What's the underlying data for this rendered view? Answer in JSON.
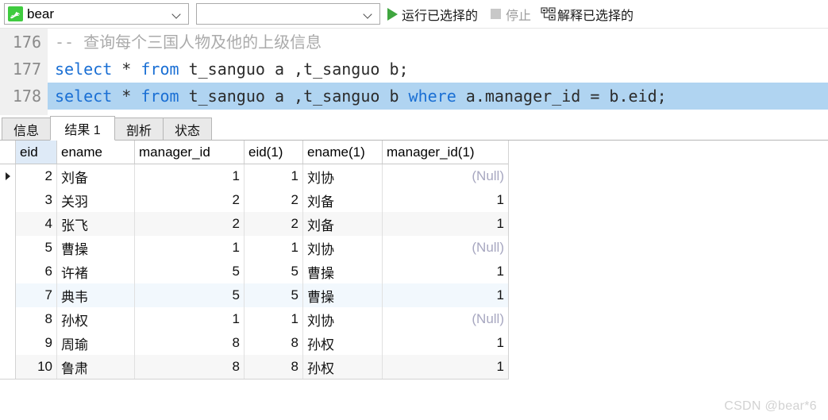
{
  "toolbar": {
    "database_value": "bear",
    "schema_value": "",
    "run_selected_label": "运行已选择的",
    "stop_label": "停止",
    "explain_selected_label": "解释已选择的",
    "accent_green": "#3fa63f"
  },
  "editor": {
    "lines": [
      {
        "number": "176",
        "selected": false,
        "tokens": [
          {
            "t": "-- 查询每个三国人物及他的上级信息",
            "k": "comment"
          }
        ]
      },
      {
        "number": "177",
        "selected": false,
        "tokens": [
          {
            "t": "select",
            "k": "keyword"
          },
          {
            "t": " * ",
            "k": "plain"
          },
          {
            "t": "from",
            "k": "keyword"
          },
          {
            "t": " t_sanguo a ,t_sanguo b;",
            "k": "plain"
          }
        ]
      },
      {
        "number": "178",
        "selected": true,
        "tokens": [
          {
            "t": "select",
            "k": "keyword"
          },
          {
            "t": " * ",
            "k": "plain"
          },
          {
            "t": "from",
            "k": "keyword"
          },
          {
            "t": " t_sanguo a ,t_sanguo b ",
            "k": "plain"
          },
          {
            "t": "where",
            "k": "keyword"
          },
          {
            "t": " a.manager_id = b.eid;",
            "k": "plain"
          }
        ]
      }
    ]
  },
  "result_tabs": [
    {
      "label": "信息",
      "active": false
    },
    {
      "label": "结果 1",
      "active": true
    },
    {
      "label": "剖析",
      "active": false
    },
    {
      "label": "状态",
      "active": false
    }
  ],
  "grid": {
    "columns": [
      "eid",
      "ename",
      "manager_id",
      "eid(1)",
      "ename(1)",
      "manager_id(1)"
    ],
    "selected_column": "eid",
    "current_row_index": 0,
    "rows": [
      {
        "cells": [
          "2",
          "刘备",
          "1",
          "1",
          "刘协",
          "(Null)"
        ],
        "stripe": false,
        "highlight": false,
        "current": true
      },
      {
        "cells": [
          "3",
          "关羽",
          "2",
          "2",
          "刘备",
          "1"
        ],
        "stripe": false,
        "highlight": false,
        "current": false
      },
      {
        "cells": [
          "4",
          "张飞",
          "2",
          "2",
          "刘备",
          "1"
        ],
        "stripe": true,
        "highlight": false,
        "current": false
      },
      {
        "cells": [
          "5",
          "曹操",
          "1",
          "1",
          "刘协",
          "(Null)"
        ],
        "stripe": false,
        "highlight": false,
        "current": false
      },
      {
        "cells": [
          "6",
          "许褚",
          "5",
          "5",
          "曹操",
          "1"
        ],
        "stripe": false,
        "highlight": false,
        "current": false
      },
      {
        "cells": [
          "7",
          "典韦",
          "5",
          "5",
          "曹操",
          "1"
        ],
        "stripe": false,
        "highlight": true,
        "current": false
      },
      {
        "cells": [
          "8",
          "孙权",
          "1",
          "1",
          "刘协",
          "(Null)"
        ],
        "stripe": false,
        "highlight": false,
        "current": false
      },
      {
        "cells": [
          "9",
          "周瑜",
          "8",
          "8",
          "孙权",
          "1"
        ],
        "stripe": false,
        "highlight": false,
        "current": false
      },
      {
        "cells": [
          "10",
          "鲁肃",
          "8",
          "8",
          "孙权",
          "1"
        ],
        "stripe": true,
        "highlight": false,
        "current": false
      }
    ]
  },
  "watermark": {
    "text": "CSDN @bear*6"
  }
}
